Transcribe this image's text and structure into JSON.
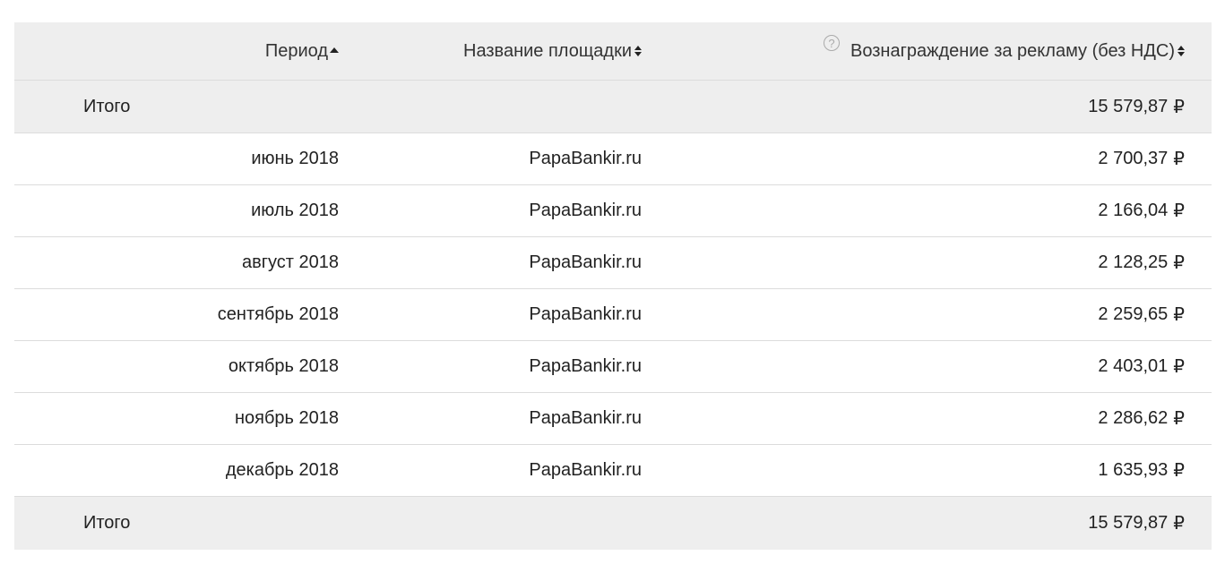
{
  "header": {
    "period": "Период",
    "site": "Название площадки",
    "reward": "Вознаграждение за рекламу (без НДС)",
    "help": "?"
  },
  "total_label": "Итого",
  "total_value": "15 579,87",
  "currency": "₽",
  "rows": [
    {
      "period": "июнь 2018",
      "site": "PapaBankir.ru",
      "reward": "2 700,37"
    },
    {
      "period": "июль 2018",
      "site": "PapaBankir.ru",
      "reward": "2 166,04"
    },
    {
      "period": "август 2018",
      "site": "PapaBankir.ru",
      "reward": "2 128,25"
    },
    {
      "period": "сентябрь 2018",
      "site": "PapaBankir.ru",
      "reward": "2 259,65"
    },
    {
      "period": "октябрь 2018",
      "site": "PapaBankir.ru",
      "reward": "2 403,01"
    },
    {
      "period": "ноябрь 2018",
      "site": "PapaBankir.ru",
      "reward": "2 286,62"
    },
    {
      "period": "декабрь 2018",
      "site": "PapaBankir.ru",
      "reward": "1 635,93"
    }
  ]
}
